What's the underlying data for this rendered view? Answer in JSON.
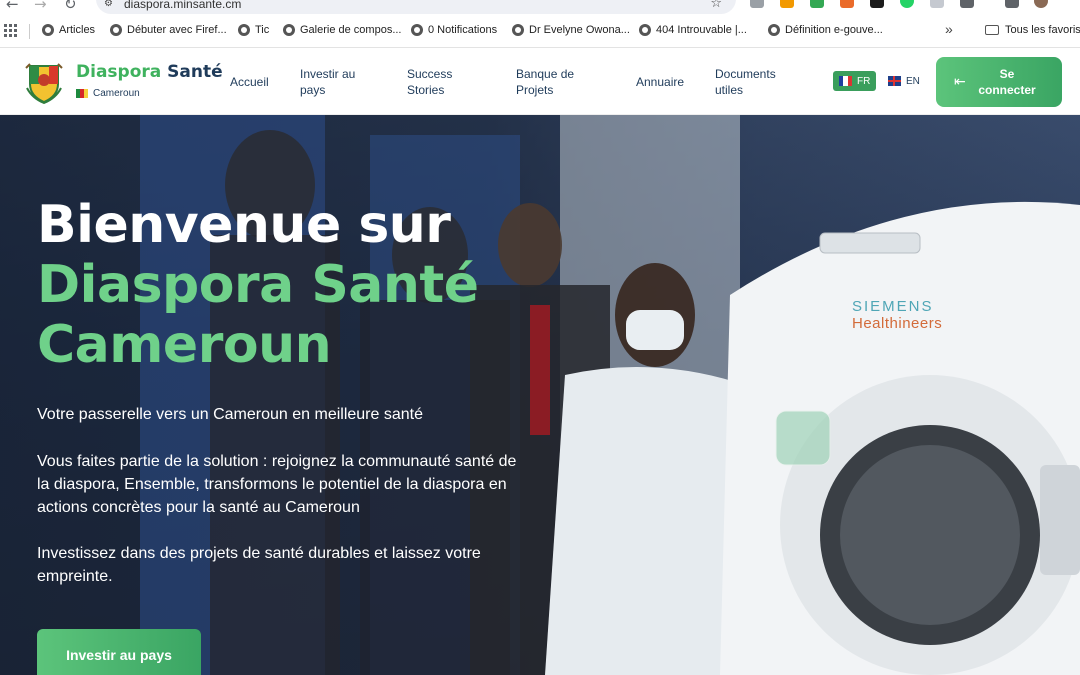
{
  "browser": {
    "url": "diaspora.minsante.cm",
    "bookmarks": [
      {
        "label": "Articles"
      },
      {
        "label": "Débuter avec Firef..."
      },
      {
        "label": "Tic"
      },
      {
        "label": "Galerie de compos..."
      },
      {
        "label": "0 Notifications"
      },
      {
        "label": "Dr Evelyne Owona..."
      },
      {
        "label": "404 Introuvable |..."
      },
      {
        "label": "Définition e-gouve..."
      }
    ],
    "more": "»",
    "all_bookmarks": "Tous les favoris"
  },
  "header": {
    "brand_part1": "Diaspora",
    "brand_part2": "Santé",
    "country": "Cameroun",
    "nav": [
      {
        "label": "Accueil"
      },
      {
        "label": "Investir au pays"
      },
      {
        "label": "Success Stories"
      },
      {
        "label": "Banque de Projets"
      },
      {
        "label": "Annuaire"
      },
      {
        "label": "Documents utiles"
      }
    ],
    "lang_fr": "FR",
    "lang_en": "EN",
    "login": "Se connecter"
  },
  "hero": {
    "title_line1": "Bienvenue sur",
    "title_line2": "Diaspora Santé",
    "title_line3": "Cameroun",
    "tagline": "Votre passerelle vers un Cameroun en meilleure santé",
    "paragraph1": "Vous faites partie de la solution : rejoignez la communauté santé de la diaspora, Ensemble, transformons le potentiel de la diaspora en actions concrètes pour la santé au Cameroun",
    "paragraph2": "Investissez dans des projets de santé durables et laissez votre empreinte.",
    "cta": "Investir au pays",
    "machine_brand": "SIEMENS",
    "machine_sub": "Healthineers"
  },
  "colors": {
    "brand_green": "#3fb25e",
    "brand_navy": "#1f3b5a",
    "hero_green": "#6fd18a",
    "button_green": "#3aa563"
  }
}
